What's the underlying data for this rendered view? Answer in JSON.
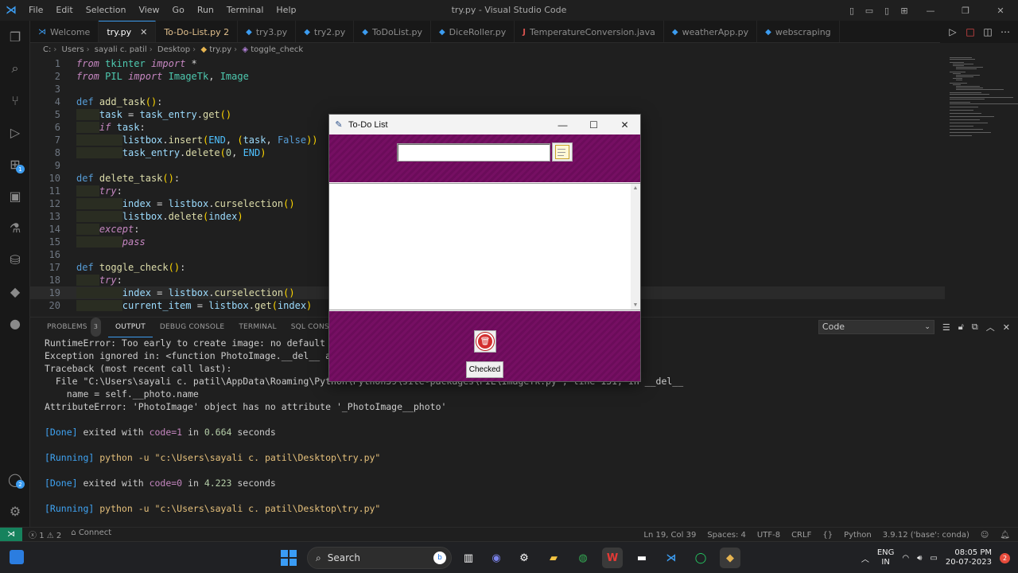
{
  "window": {
    "title": "try.py - Visual Studio Code",
    "menu": [
      "File",
      "Edit",
      "Selection",
      "View",
      "Go",
      "Run",
      "Terminal",
      "Help"
    ]
  },
  "tabs": [
    {
      "label": "Welcome",
      "icon": "vscode-icon",
      "active": false
    },
    {
      "label": "try.py",
      "icon": "python-icon",
      "active": true
    },
    {
      "label": "To-Do-List.py 2",
      "icon": "python-icon",
      "active": false,
      "modified": true
    },
    {
      "label": "try3.py",
      "icon": "python-icon",
      "active": false
    },
    {
      "label": "try2.py",
      "icon": "python-icon",
      "active": false
    },
    {
      "label": "ToDoList.py",
      "icon": "python-icon",
      "active": false
    },
    {
      "label": "DiceRoller.py",
      "icon": "python-icon",
      "active": false
    },
    {
      "label": "TemperatureConversion.java",
      "icon": "java-icon",
      "active": false
    },
    {
      "label": "weatherApp.py",
      "icon": "python-icon",
      "active": false
    },
    {
      "label": "webscraping",
      "icon": "python-icon",
      "active": false
    }
  ],
  "breadcrumb": [
    "C:",
    "Users",
    "sayali c. patil",
    "Desktop",
    "try.py",
    "toggle_check"
  ],
  "editor": {
    "current_line": 19,
    "line_numbers": [
      "1",
      "2",
      "3",
      "4",
      "5",
      "6",
      "7",
      "8",
      "9",
      "10",
      "11",
      "12",
      "13",
      "14",
      "15",
      "16",
      "17",
      "18",
      "19",
      "20"
    ]
  },
  "panel": {
    "tabs": [
      "PROBLEMS",
      "OUTPUT",
      "DEBUG CONSOLE",
      "TERMINAL",
      "SQL CONSOLE"
    ],
    "problems_count": "3",
    "active_tab": "OUTPUT",
    "channel": "Code",
    "output": {
      "l1": "RuntimeError: Too early to create image: no default root window",
      "l2": "Exception ignored in: <function PhotoImage.__del__ at 0x000001D5C6A4B700>",
      "l3": "Traceback (most recent call last):",
      "l4": "  File \"C:\\Users\\sayali c. patil\\AppData\\Roaming\\Python\\Python39\\site-packages\\PIL\\ImageTk.py\", line 131, in __del__",
      "l5": "    name = self.__photo.name",
      "l6": "AttributeError: 'PhotoImage' object has no attribute '_PhotoImage__photo'",
      "done1_tag": "[Done]",
      "done1_text": " exited with ",
      "done1_code": "code=1",
      "done1_in": " in ",
      "done1_time": "0.664",
      "done1_unit": " seconds",
      "run1_tag": "[Running]",
      "run1_cmd": " python -u \"c:\\Users\\sayali c. patil\\Desktop\\try.py\"",
      "done2_tag": "[Done]",
      "done2_text": " exited with ",
      "done2_code": "code=0",
      "done2_in": " in ",
      "done2_time": "4.223",
      "done2_unit": " seconds",
      "run2_tag": "[Running]",
      "run2_cmd": " python -u \"c:\\Users\\sayali c. patil\\Desktop\\try.py\""
    }
  },
  "statusbar": {
    "errors": "1",
    "warnings": "2",
    "connect": "Connect",
    "position": "Ln 19, Col 39",
    "spaces": "Spaces: 4",
    "encoding": "UTF-8",
    "eol": "CRLF",
    "brackets": "{}",
    "language": "Python",
    "interpreter": "3.9.12 ('base': conda)"
  },
  "tk_window": {
    "title": "To-Do List",
    "entry_value": "",
    "checked_label": "Checked"
  },
  "taskbar": {
    "search_label": "Search",
    "lang": "ENG",
    "region": "IN",
    "time": "08:05 PM",
    "date": "20-07-2023",
    "notifications": "2"
  },
  "colors": {
    "accent": "#3c9cf0",
    "tk_purple": "#760f63",
    "error": "#f14c4c",
    "remote": "#16825d"
  }
}
